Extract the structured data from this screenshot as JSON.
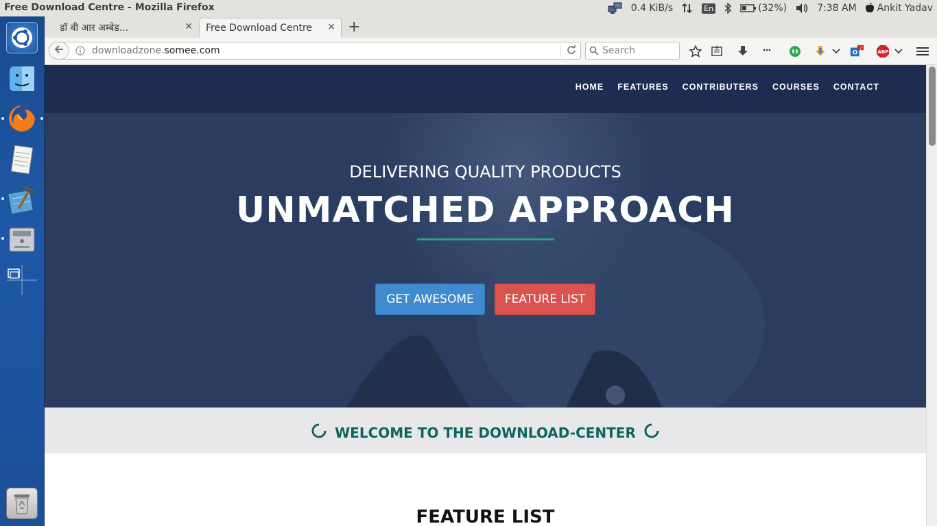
{
  "window": {
    "title": "Free Download Centre - Mozilla Firefox"
  },
  "tray": {
    "network_speed": "0.4 KiB/s",
    "keyboard_lang": "En",
    "battery": "(32%)",
    "time": "7:38 AM",
    "user": "Ankit Yadav"
  },
  "launcher": {
    "items": [
      "ubuntu-dash-icon",
      "finder-icon",
      "firefox-icon",
      "text-editor-icon",
      "xcode-icon",
      "disk-drive-icon",
      "workspace-switcher-icon",
      "trash-icon"
    ]
  },
  "tabs": [
    {
      "label": "डॉ बी आर अम्बेड...",
      "active": false
    },
    {
      "label": "Free Download Centre",
      "active": true
    }
  ],
  "urlbar": {
    "url_prefix": "downloadzone.",
    "url_domain": "somee.com"
  },
  "search": {
    "placeholder": "Search"
  },
  "toolbar": {
    "notification_badge": "7",
    "abp_label": "ABP"
  },
  "site": {
    "nav": [
      "HOME",
      "FEATURES",
      "CONTRIBUTERS",
      "COURSES",
      "CONTACT"
    ],
    "hero": {
      "subtitle": "DELIVERING QUALITY PRODUCTS",
      "title": "UNMATCHED APPROACH",
      "primary_button": "GET AWESOME",
      "secondary_button": "FEATURE LIST"
    },
    "welcome": "WELCOME TO THE DOWNLOAD-CENTER",
    "feature_heading": "FEATURE LIST"
  },
  "colors": {
    "nav_bg": "#1d2c50",
    "hero_bg": "#2a3d60",
    "accent_green": "#2aa083",
    "btn_blue": "#3e8bd0",
    "btn_red": "#d9534f",
    "welcome_text": "#0e6461"
  }
}
